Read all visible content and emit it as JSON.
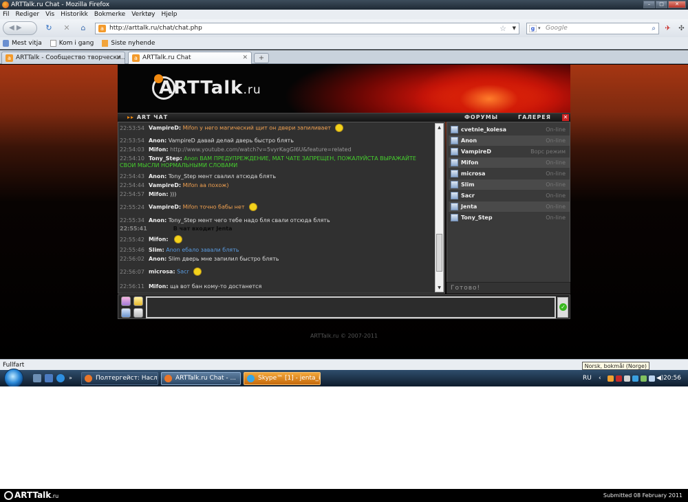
{
  "window": {
    "title": "ARTTalk.ru Chat - Mozilla Firefox",
    "buttons": [
      "–",
      "□",
      "✕"
    ]
  },
  "menu": [
    "Fil",
    "Rediger",
    "Vis",
    "Historikk",
    "Bokmerke",
    "Verktøy",
    "Hjelp"
  ],
  "nav": {
    "url": "http://arttalk.ru/chat/chat.php",
    "search_placeholder": "Google"
  },
  "bookmarks": [
    "Mest vitja",
    "Kom i gang",
    "Siste nyhende"
  ],
  "tabs": [
    {
      "label": "ARTTalk - Сообщество творчески..."
    },
    {
      "label": "ARTTalk.ru Chat"
    }
  ],
  "site": {
    "logo_text": "ARTTalk",
    "logo_suffix": ".ru",
    "chat_label": "ART ЧАТ",
    "nav_links": [
      "ФОРУМЫ",
      "ГАЛЕРЕЯ"
    ],
    "copyright": "ARTTalk.ru © 2007-2011",
    "ready_text": "Готово!"
  },
  "messages": [
    {
      "time": "22:53:54",
      "nick": "VampireD:",
      "text": "Mifon у него магический щит он двери запиливает",
      "color": "orange",
      "emoji": true
    },
    {
      "time": "22:53:54",
      "nick": "Anon:",
      "text": "VampireD давай делай дверь быстро блять",
      "color": "white"
    },
    {
      "time": "22:54:03",
      "nick": "Mifon:",
      "text": "http://www.youtube.com/watch?v=5vyrKagGI6U&feature=related",
      "color": "grey"
    },
    {
      "time": "22:54:10",
      "nick": "Tony_Step:",
      "text": "Anon ВАМ ПРЕДУПРЕЖДЕНИЕ, МАТ ЧАТЕ ЗАПРЕЩЕН, ПОЖАЛУЙСТА ВЫРАЖАЙТЕ СВОИ МЫСЛИ НОРМАЛЬНЫМИ СЛОВАМИ",
      "color": "green"
    },
    {
      "time": "22:54:43",
      "nick": "Anon:",
      "text": "Tony_Step мент свалил атсюда блять",
      "color": "white"
    },
    {
      "time": "22:54:44",
      "nick": "VampireD:",
      "text": "Mifon аа похож)",
      "color": "orange"
    },
    {
      "time": "22:54:57",
      "nick": "Mifon:",
      "text": ")))",
      "color": "white"
    },
    {
      "time": "22:55:24",
      "nick": "VampireD:",
      "text": "Mifon точно бабы нет",
      "color": "orange",
      "emoji": true
    },
    {
      "time": "22:55:34",
      "nick": "Anon:",
      "text": "Tony_Step мент чего тебе надо бля свали отсюда блять",
      "color": "white"
    },
    {
      "time": "22:55:41",
      "nick": "",
      "text": "В чат входит Jenta",
      "color": "system"
    },
    {
      "time": "22:55:42",
      "nick": "Mifon:",
      "text": "",
      "color": "white",
      "emoji": true
    },
    {
      "time": "22:55:46",
      "nick": "Slim:",
      "text": "Anon ебало завали блять",
      "color": "blue"
    },
    {
      "time": "22:56:02",
      "nick": "Anon:",
      "text": "Slim дверь мне запилил быстро блять",
      "color": "white"
    },
    {
      "time": "22:56:07",
      "nick": "microsa:",
      "text": "Sacr",
      "color": "blue",
      "emoji": true
    },
    {
      "time": "22:56:11",
      "nick": "Mifon:",
      "text": "ща вот бан кому-то достанется",
      "color": "white"
    }
  ],
  "users": [
    {
      "name": "cvetnie_kolesa",
      "status": "On-line"
    },
    {
      "name": "Anon",
      "status": "On-line"
    },
    {
      "name": "VampireD",
      "status": "Ворс режим"
    },
    {
      "name": "Mifon",
      "status": "On-line"
    },
    {
      "name": "microsa",
      "status": "On-line"
    },
    {
      "name": "Slim",
      "status": "On-line"
    },
    {
      "name": "Sacr",
      "status": "On-line"
    },
    {
      "name": "Jenta",
      "status": "On-line"
    },
    {
      "name": "Tony_Step",
      "status": "On-line"
    }
  ],
  "statusbar": {
    "text": "Fullfart",
    "language_tooltip": "Norsk, bokmål (Norge)"
  },
  "taskbar": {
    "tasks": [
      "Полтергейст: Насл...",
      "ARTTalk.ru Chat - ...",
      "Skype™ [1] - jenta_ir..."
    ],
    "lang": "RU",
    "clock": "20:56"
  },
  "footer": {
    "logo": "ARTTalk",
    "logo_suffix": ".ru",
    "submitted": "Submitted 08 February 2011"
  },
  "colors": {
    "accent_orange": "#f28a10",
    "chat_bg": "#303030",
    "green": "#46d02e",
    "blue": "#5a9be0"
  }
}
